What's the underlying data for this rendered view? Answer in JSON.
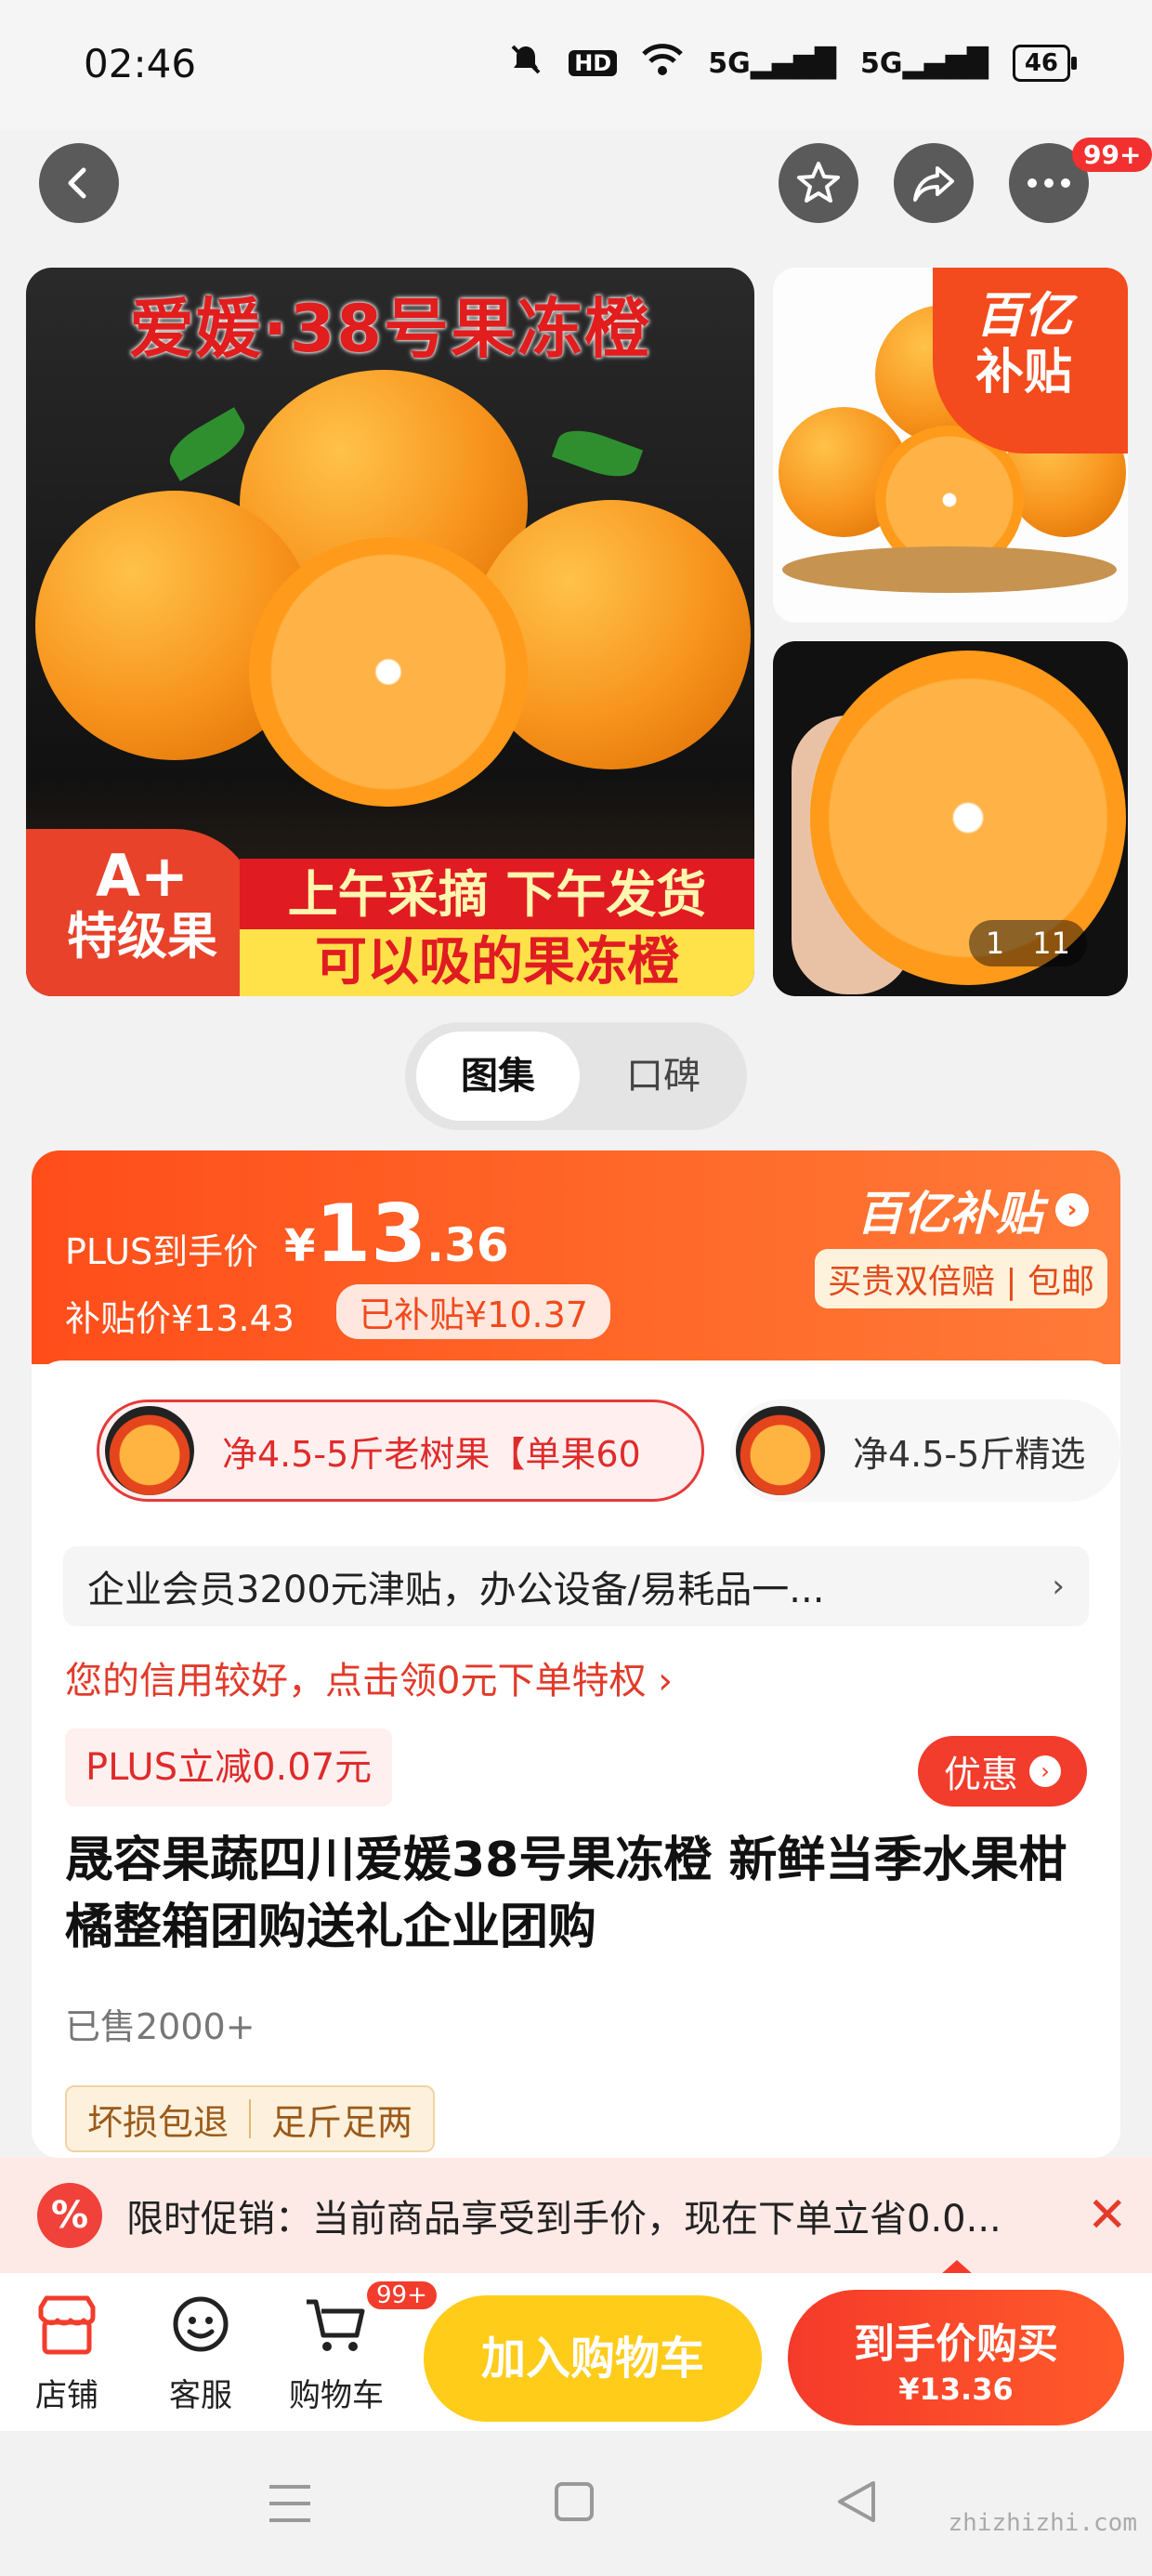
{
  "status_bar": {
    "time": "02:46",
    "hd_label": "HD",
    "signal_1": "5G",
    "signal_2": "5G",
    "battery": "46",
    "icons": [
      "mute-icon",
      "hd-icon",
      "wifi-icon",
      "signal-icon",
      "signal-icon",
      "battery-icon"
    ]
  },
  "nav": {
    "icons": [
      "back-icon",
      "star-icon",
      "share-icon",
      "more-icon"
    ],
    "more_badge": "99+"
  },
  "gallery": {
    "main_title": "爱媛·38号果冻橙",
    "badge_line1": "A+",
    "badge_line2": "特级果",
    "slogan_1": "上午采摘 下午发货",
    "slogan_2": "可以吸的果冻橙",
    "side_tag_1": "百亿",
    "side_tag_2": "补贴",
    "counter_current": "1",
    "counter_total": "11"
  },
  "tabs": [
    {
      "label": "图集",
      "active": true
    },
    {
      "label": "口碑",
      "active": false
    }
  ],
  "price": {
    "plus_label": "PLUS到手价",
    "currency": "¥",
    "integer": "13",
    "decimal": ".36",
    "subsidy_price": "补贴价¥13.43",
    "subsidized": "已补贴¥10.37",
    "program_title": "百亿补贴",
    "guarantee": "买贵双倍赔 | 包邮"
  },
  "variants": [
    {
      "label": "净4.5-5斤老树果【单果60",
      "active": true
    },
    {
      "label": "净4.5-5斤精选",
      "active": false
    }
  ],
  "enterprise_banner": "企业会员3200元津贴，办公设备/易耗品一...",
  "credit_tip": "您的信用较好，点击领0元下单特权 ›",
  "plus_discount": "PLUS立减0.07元",
  "offer_button": "优惠",
  "product": {
    "title": "晟容果蔬四川爱媛38号果冻橙 新鲜当季水果柑橘整箱团购送礼企业团购",
    "sold": "已售2000+",
    "guarantees": [
      "坏损包退",
      "足斤足两"
    ]
  },
  "promo": {
    "icon_text": "%",
    "text": "限时促销：当前商品享受到手价，现在下单立省0.0..."
  },
  "bottom_bar": {
    "store_label": "店铺",
    "service_label": "客服",
    "cart_label": "购物车",
    "cart_badge": "99+",
    "add_to_cart": "加入购物车",
    "buy_label": "到手价购买",
    "buy_price": "¥13.36"
  },
  "watermark": "zhizhizhi.com",
  "colors": {
    "accent_red": "#f23c2c",
    "accent_orange": "#ff5a1f",
    "add_cart_yellow": "#ffcc1a"
  }
}
